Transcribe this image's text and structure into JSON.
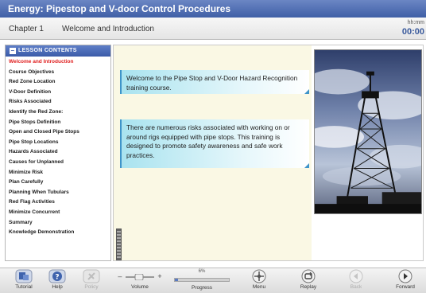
{
  "app": {
    "title": "Energy: Pipestop and V-door Control Procedures"
  },
  "chapter": {
    "label": "Chapter 1",
    "title": "Welcome and Introduction"
  },
  "timer": {
    "label": "hh:mm",
    "value": "00:00"
  },
  "toc": {
    "header": "LESSON CONTENTS",
    "items": [
      "Welcome and Introduction",
      "Course Objectives",
      "Red Zone Location",
      "V-Door Definition",
      "Risks Associated",
      "Identify the Red Zone:",
      "Pipe Stops Definition",
      "Open and Closed Pipe Stops",
      "Pipe Stop Locations",
      "Hazards Associated",
      "Causes for Unplanned",
      "Minimize Risk",
      "Plan Carefully",
      "Planning When Tubulars",
      "Red Flag Activities",
      "Minimize Concurrent",
      "Summary",
      "Knowledge Demonstration"
    ],
    "active_index": 0
  },
  "content": {
    "bubble1": "Welcome to the Pipe Stop and V-Door Hazard Recognition training course.",
    "bubble2": "There are numerous risks associated with working on or around rigs equipped with pipe stops. This training is designed to promote safety awareness and safe work practices."
  },
  "controls": {
    "tutorial": "Tutorial",
    "help": "Help",
    "policy": "Policy",
    "volume": "Volume",
    "progress": "Progress",
    "progress_pct": "6%",
    "progress_value": 0.06,
    "menu": "Menu",
    "replay": "Replay",
    "back": "Back",
    "forward": "Forward"
  },
  "icons": {
    "tutorial": "tutorial-icon",
    "help": "help-icon",
    "policy": "policy-icon",
    "menu": "menu-icon",
    "replay": "replay-icon",
    "back": "back-icon",
    "forward": "forward-icon"
  },
  "colors": {
    "title_bar": "#3f5fa6",
    "accent_blue": "#3a5a9c",
    "active_lesson": "#e02020",
    "bubble": "#a9e3ef"
  }
}
